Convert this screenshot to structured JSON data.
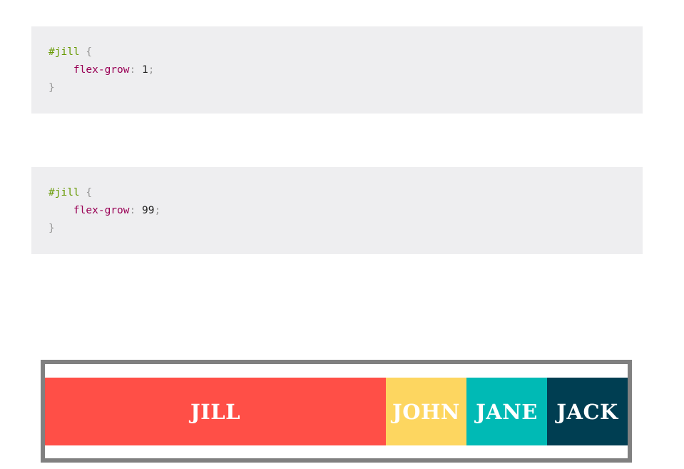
{
  "code_blocks": [
    {
      "selector": "#jill",
      "open_brace": "{",
      "property": "flex-grow",
      "colon": ":",
      "value": "1",
      "semicolon": ";",
      "close_brace": "}"
    },
    {
      "selector": "#jill",
      "open_brace": "{",
      "property": "flex-grow",
      "colon": ":",
      "value": "99",
      "semicolon": ";",
      "close_brace": "}"
    }
  ],
  "demo": {
    "items": [
      {
        "label": "JILL",
        "color": "#ff4f47"
      },
      {
        "label": "JOHN",
        "color": "#fdd660"
      },
      {
        "label": "JANE",
        "color": "#00bab5"
      },
      {
        "label": "JACK",
        "color": "#003e52"
      }
    ]
  }
}
